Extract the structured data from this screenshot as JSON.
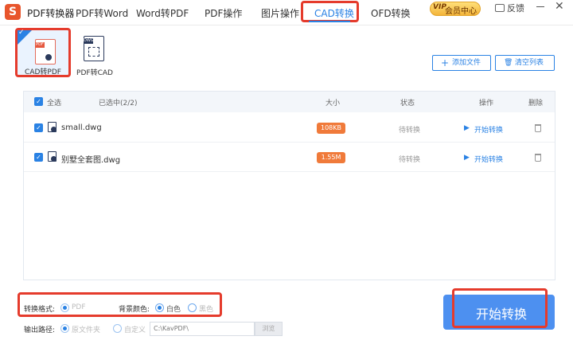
{
  "app": {
    "title": "PDF转换器"
  },
  "nav": {
    "tabs": [
      {
        "label": "PDF转Word"
      },
      {
        "label": "Word转PDF"
      },
      {
        "label": "PDF操作"
      },
      {
        "label": "图片操作"
      },
      {
        "label": "CAD转换",
        "active": true
      },
      {
        "label": "OFD转换"
      }
    ]
  },
  "window": {
    "vip_badge": "VIP",
    "vip_label": "会员中心",
    "feedback_label": "反馈",
    "close_glyph": "✕"
  },
  "modes": {
    "cad_to_pdf": {
      "label": "CAD转PDF",
      "icon_tag": "PDF",
      "selected": true
    },
    "pdf_to_cad": {
      "label": "PDF转CAD",
      "icon_tag": "DWG"
    }
  },
  "toolbar": {
    "add_files_label": "添加文件",
    "clear_list_label": "清空列表",
    "add_glyph": "+",
    "clear_glyph": "🗑"
  },
  "table": {
    "select_all_label": "全选",
    "selected_count": "已选中(2/2)",
    "columns": {
      "size": "大小",
      "status": "状态",
      "action": "操作",
      "delete": "删除"
    },
    "rows": [
      {
        "name": "small.dwg",
        "size": "108KB",
        "status": "待转换",
        "action": "开始转换",
        "checked": true
      },
      {
        "name": "别墅全套图.dwg",
        "size": "1.55M",
        "status": "待转换",
        "action": "开始转换",
        "checked": true
      }
    ],
    "check_glyph": "✓",
    "play_glyph": "▶"
  },
  "options": {
    "format_label": "转换格式:",
    "format_value": "PDF",
    "bg_label": "背景颜色:",
    "bg_options": [
      "白色",
      "黑色"
    ],
    "bg_selected": "白色",
    "output_label": "输出路径:",
    "output_options": [
      "原文件夹",
      "自定义"
    ],
    "output_selected": "原文件夹",
    "path_value": "C:\\KavPDF\\",
    "browse_label": "浏览"
  },
  "start_button": {
    "label": "开始转换"
  },
  "colors": {
    "accent": "#2a82e4",
    "highlight": "#e53b2c",
    "size_badge": "#f07a3a",
    "start_button": "#4d90f0"
  }
}
